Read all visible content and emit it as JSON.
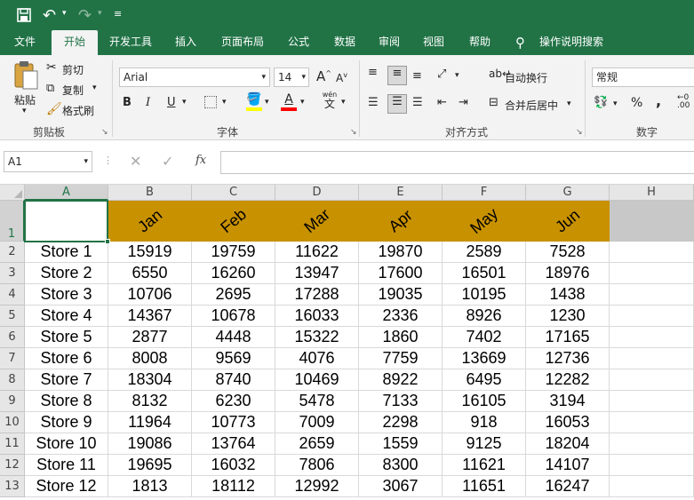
{
  "quick_access": {
    "save_icon": "save-icon",
    "undo_icon": "undo-icon",
    "redo_icon": "redo-icon",
    "customize_icon": "customize-icon"
  },
  "tabs": [
    "文件",
    "开始",
    "开发工具",
    "插入",
    "页面布局",
    "公式",
    "数据",
    "审阅",
    "视图",
    "帮助"
  ],
  "tell_me": "操作说明搜索",
  "clipboard": {
    "paste": "粘贴",
    "cut": "剪切",
    "copy": "复制",
    "format_painter": "格式刷",
    "group": "剪贴板"
  },
  "font": {
    "name": "Arial",
    "size": "14",
    "grow": "A",
    "shrink": "A",
    "bold": "B",
    "italic": "I",
    "underline": "U",
    "phonetic_top": "wén",
    "phonetic_bottom": "文",
    "group": "字体",
    "fill_color": "#ffff00",
    "font_color": "#ff0000"
  },
  "alignment": {
    "wrap": "自动换行",
    "merge": "合并后居中",
    "group": "对齐方式"
  },
  "number": {
    "format": "常规",
    "percent": "%",
    "comma": ",",
    "group": "数字"
  },
  "formula_bar": {
    "name_box": "A1",
    "fx": "fx",
    "formula": ""
  },
  "columns": [
    "A",
    "B",
    "C",
    "D",
    "E",
    "F",
    "G",
    "H"
  ],
  "rows": [
    "1",
    "2",
    "3",
    "4",
    "5",
    "6",
    "7",
    "8",
    "9",
    "10",
    "11",
    "12",
    "13"
  ],
  "months": [
    "Jan",
    "Feb",
    "Mar",
    "Apr",
    "May",
    "Jun"
  ],
  "header_color": "#c89100",
  "table": [
    [
      "Store 1",
      "15919",
      "19759",
      "11622",
      "19870",
      "2589",
      "7528"
    ],
    [
      "Store 2",
      "6550",
      "16260",
      "13947",
      "17600",
      "16501",
      "18976"
    ],
    [
      "Store 3",
      "10706",
      "2695",
      "17288",
      "19035",
      "10195",
      "1438"
    ],
    [
      "Store 4",
      "14367",
      "10678",
      "16033",
      "2336",
      "8926",
      "1230"
    ],
    [
      "Store 5",
      "2877",
      "4448",
      "15322",
      "1860",
      "7402",
      "17165"
    ],
    [
      "Store 6",
      "8008",
      "9569",
      "4076",
      "7759",
      "13669",
      "12736"
    ],
    [
      "Store 7",
      "18304",
      "8740",
      "10469",
      "8922",
      "6495",
      "12282"
    ],
    [
      "Store 8",
      "8132",
      "6230",
      "5478",
      "7133",
      "16105",
      "3194"
    ],
    [
      "Store 9",
      "11964",
      "10773",
      "7009",
      "2298",
      "918",
      "16053"
    ],
    [
      "Store 10",
      "19086",
      "13764",
      "2659",
      "1559",
      "9125",
      "18204"
    ],
    [
      "Store 11",
      "19695",
      "16032",
      "7806",
      "8300",
      "11621",
      "14107"
    ],
    [
      "Store 12",
      "1813",
      "18112",
      "12992",
      "3067",
      "11651",
      "16247"
    ]
  ]
}
